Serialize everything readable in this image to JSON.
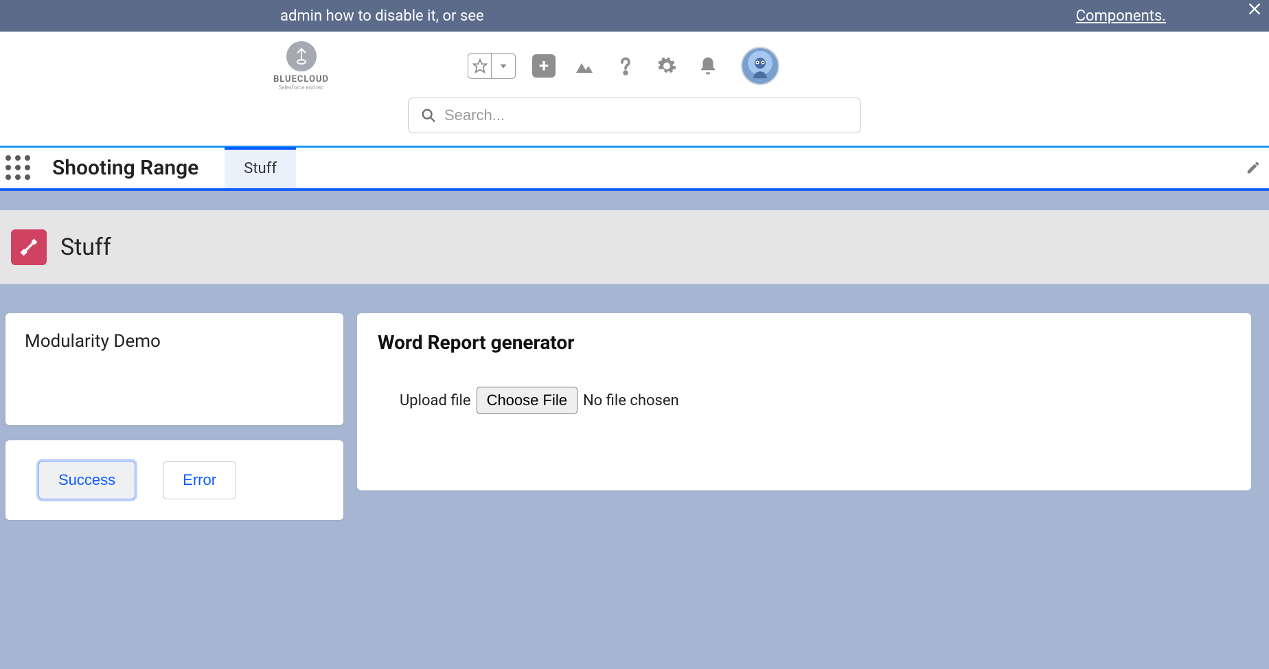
{
  "banner": {
    "left_text": "admin how to disable it, or see",
    "right_link": "Components."
  },
  "brand": {
    "name": "BLUECLOUD",
    "sub": "Salesforce and etc"
  },
  "search": {
    "placeholder": "Search..."
  },
  "nav": {
    "app_name": "Shooting Range",
    "tab": "Stuff"
  },
  "page": {
    "title": "Stuff"
  },
  "cards": {
    "modularity_title": "Modularity Demo",
    "success_label": "Success",
    "error_label": "Error",
    "report_title": "Word Report generator",
    "upload_label": "Upload file",
    "choose_file_label": "Choose File",
    "file_status": "No file chosen"
  }
}
